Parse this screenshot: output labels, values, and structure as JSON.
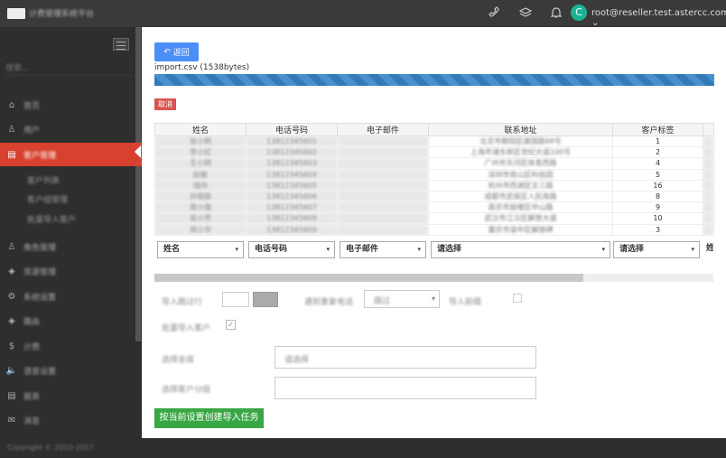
{
  "app": {
    "title": "计费管理系统平台"
  },
  "user": {
    "avatar_letter": "C",
    "email": "root@reseller.test.astercc.com",
    "caret": "⌄"
  },
  "sidebar": {
    "search_placeholder": "搜索...",
    "items": [
      {
        "icon": "⌂",
        "label": "首页"
      },
      {
        "icon": "♙",
        "label": "用户"
      },
      {
        "icon": "▤",
        "label": "客户管理"
      },
      {
        "icon": "♙",
        "label": "角色管理"
      },
      {
        "icon": "◈",
        "label": "资源管理"
      },
      {
        "icon": "⚙",
        "label": "系统设置"
      },
      {
        "icon": "◈",
        "label": "路由"
      },
      {
        "icon": "$",
        "label": "计费"
      },
      {
        "icon": "🔈",
        "label": "语音设置"
      },
      {
        "icon": "▤",
        "label": "报表"
      },
      {
        "icon": "✉",
        "label": "消息"
      }
    ],
    "subitems": [
      "客户列表",
      "客户组管理",
      "批量导入客户"
    ]
  },
  "footer": {
    "copyright": "Copyright © 2010-2017"
  },
  "content": {
    "back_label": "返回",
    "file_info": "import.csv (1538bytes)",
    "progress_percent": 100,
    "cancel_label": "取消",
    "table": {
      "headers": [
        "姓名",
        "电话号码",
        "电子邮件",
        "联系地址",
        "客户标签"
      ],
      "rows": [
        [
          "张小明",
          "13812345601",
          "",
          "北京市朝阳区建国路88号",
          "1"
        ],
        [
          "李小红",
          "13812345602",
          "",
          "上海市浦东新区世纪大道100号",
          "2"
        ],
        [
          "王小刚",
          "13812345603",
          "",
          "广州市天河区体育西路",
          "4"
        ],
        [
          "赵敏",
          "13812345604",
          "",
          "深圳市南山区科技园",
          "5"
        ],
        [
          "钱伟",
          "13812345605",
          "",
          "杭州市西湖区文三路",
          "16"
        ],
        [
          "孙丽丽",
          "13812345606",
          "",
          "成都市武侯区人民南路",
          "8"
        ],
        [
          "周小强",
          "13812345607",
          "",
          "南京市鼓楼区中山路",
          "9"
        ],
        [
          "吴小芳",
          "13812345608",
          "",
          "武汉市江汉区解放大道",
          "10"
        ],
        [
          "郑小华",
          "13812345609",
          "",
          "重庆市渝中区解放碑",
          "3"
        ]
      ]
    },
    "mapping": [
      {
        "label": "姓名",
        "caret": "▾"
      },
      {
        "label": "电话号码",
        "caret": "▾"
      },
      {
        "label": "电子邮件",
        "caret": "▾"
      },
      {
        "label": "请选择",
        "caret": "▾"
      },
      {
        "label": "请选择",
        "caret": "▾"
      },
      {
        "label": "姓"
      }
    ],
    "options": {
      "skip_rows_label": "导入跳过行",
      "dup_strategy_label": "遇到重复电话",
      "dup_strategy_value": "跳过",
      "import_prefix_label": "导入前缀",
      "overwrite_label": "批量导入客户",
      "agent_label": "选择坐席",
      "agent_value": "请选择",
      "group_label": "选择客户分组"
    },
    "create_label": "按当前设置创建导入任务"
  }
}
